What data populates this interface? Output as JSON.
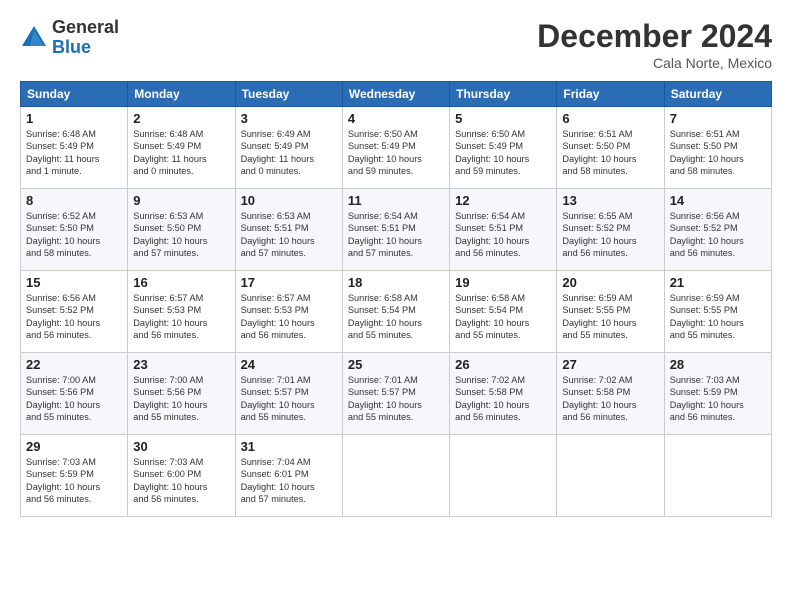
{
  "header": {
    "logo_general": "General",
    "logo_blue": "Blue",
    "month_title": "December 2024",
    "location": "Cala Norte, Mexico"
  },
  "columns": [
    "Sunday",
    "Monday",
    "Tuesday",
    "Wednesday",
    "Thursday",
    "Friday",
    "Saturday"
  ],
  "weeks": [
    [
      {
        "day": "1",
        "info": "Sunrise: 6:48 AM\nSunset: 5:49 PM\nDaylight: 11 hours\nand 1 minute."
      },
      {
        "day": "2",
        "info": "Sunrise: 6:48 AM\nSunset: 5:49 PM\nDaylight: 11 hours\nand 0 minutes."
      },
      {
        "day": "3",
        "info": "Sunrise: 6:49 AM\nSunset: 5:49 PM\nDaylight: 11 hours\nand 0 minutes."
      },
      {
        "day": "4",
        "info": "Sunrise: 6:50 AM\nSunset: 5:49 PM\nDaylight: 10 hours\nand 59 minutes."
      },
      {
        "day": "5",
        "info": "Sunrise: 6:50 AM\nSunset: 5:49 PM\nDaylight: 10 hours\nand 59 minutes."
      },
      {
        "day": "6",
        "info": "Sunrise: 6:51 AM\nSunset: 5:50 PM\nDaylight: 10 hours\nand 58 minutes."
      },
      {
        "day": "7",
        "info": "Sunrise: 6:51 AM\nSunset: 5:50 PM\nDaylight: 10 hours\nand 58 minutes."
      }
    ],
    [
      {
        "day": "8",
        "info": "Sunrise: 6:52 AM\nSunset: 5:50 PM\nDaylight: 10 hours\nand 58 minutes."
      },
      {
        "day": "9",
        "info": "Sunrise: 6:53 AM\nSunset: 5:50 PM\nDaylight: 10 hours\nand 57 minutes."
      },
      {
        "day": "10",
        "info": "Sunrise: 6:53 AM\nSunset: 5:51 PM\nDaylight: 10 hours\nand 57 minutes."
      },
      {
        "day": "11",
        "info": "Sunrise: 6:54 AM\nSunset: 5:51 PM\nDaylight: 10 hours\nand 57 minutes."
      },
      {
        "day": "12",
        "info": "Sunrise: 6:54 AM\nSunset: 5:51 PM\nDaylight: 10 hours\nand 56 minutes."
      },
      {
        "day": "13",
        "info": "Sunrise: 6:55 AM\nSunset: 5:52 PM\nDaylight: 10 hours\nand 56 minutes."
      },
      {
        "day": "14",
        "info": "Sunrise: 6:56 AM\nSunset: 5:52 PM\nDaylight: 10 hours\nand 56 minutes."
      }
    ],
    [
      {
        "day": "15",
        "info": "Sunrise: 6:56 AM\nSunset: 5:52 PM\nDaylight: 10 hours\nand 56 minutes."
      },
      {
        "day": "16",
        "info": "Sunrise: 6:57 AM\nSunset: 5:53 PM\nDaylight: 10 hours\nand 56 minutes."
      },
      {
        "day": "17",
        "info": "Sunrise: 6:57 AM\nSunset: 5:53 PM\nDaylight: 10 hours\nand 56 minutes."
      },
      {
        "day": "18",
        "info": "Sunrise: 6:58 AM\nSunset: 5:54 PM\nDaylight: 10 hours\nand 55 minutes."
      },
      {
        "day": "19",
        "info": "Sunrise: 6:58 AM\nSunset: 5:54 PM\nDaylight: 10 hours\nand 55 minutes."
      },
      {
        "day": "20",
        "info": "Sunrise: 6:59 AM\nSunset: 5:55 PM\nDaylight: 10 hours\nand 55 minutes."
      },
      {
        "day": "21",
        "info": "Sunrise: 6:59 AM\nSunset: 5:55 PM\nDaylight: 10 hours\nand 55 minutes."
      }
    ],
    [
      {
        "day": "22",
        "info": "Sunrise: 7:00 AM\nSunset: 5:56 PM\nDaylight: 10 hours\nand 55 minutes."
      },
      {
        "day": "23",
        "info": "Sunrise: 7:00 AM\nSunset: 5:56 PM\nDaylight: 10 hours\nand 55 minutes."
      },
      {
        "day": "24",
        "info": "Sunrise: 7:01 AM\nSunset: 5:57 PM\nDaylight: 10 hours\nand 55 minutes."
      },
      {
        "day": "25",
        "info": "Sunrise: 7:01 AM\nSunset: 5:57 PM\nDaylight: 10 hours\nand 55 minutes."
      },
      {
        "day": "26",
        "info": "Sunrise: 7:02 AM\nSunset: 5:58 PM\nDaylight: 10 hours\nand 56 minutes."
      },
      {
        "day": "27",
        "info": "Sunrise: 7:02 AM\nSunset: 5:58 PM\nDaylight: 10 hours\nand 56 minutes."
      },
      {
        "day": "28",
        "info": "Sunrise: 7:03 AM\nSunset: 5:59 PM\nDaylight: 10 hours\nand 56 minutes."
      }
    ],
    [
      {
        "day": "29",
        "info": "Sunrise: 7:03 AM\nSunset: 5:59 PM\nDaylight: 10 hours\nand 56 minutes."
      },
      {
        "day": "30",
        "info": "Sunrise: 7:03 AM\nSunset: 6:00 PM\nDaylight: 10 hours\nand 56 minutes."
      },
      {
        "day": "31",
        "info": "Sunrise: 7:04 AM\nSunset: 6:01 PM\nDaylight: 10 hours\nand 57 minutes."
      },
      {
        "day": "",
        "info": ""
      },
      {
        "day": "",
        "info": ""
      },
      {
        "day": "",
        "info": ""
      },
      {
        "day": "",
        "info": ""
      }
    ]
  ]
}
